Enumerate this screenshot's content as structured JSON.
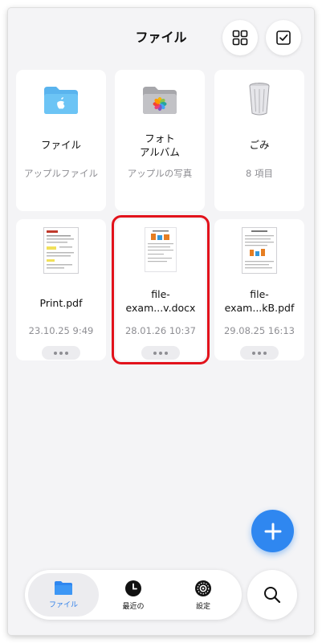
{
  "header": {
    "title": "ファイル",
    "grid_icon": "grid-view-icon",
    "select_icon": "checkbox-select-icon"
  },
  "folders": [
    {
      "name": "ファイル",
      "subtitle": "アップルファイル",
      "icon": "blue-folder-apple-icon"
    },
    {
      "name": "フォト\nアルバム",
      "subtitle": "アップルの写真",
      "icon": "gray-folder-photos-icon"
    },
    {
      "name": "ごみ",
      "subtitle": "8 項目",
      "icon": "trash-bin-icon"
    }
  ],
  "files": [
    {
      "name": "Print.pdf",
      "date": "23.10.25 9:49",
      "icon": "pdf-document-thumbnail"
    },
    {
      "name": "file-\nexam...v.docx",
      "date": "28.01.26 10:37",
      "icon": "docx-document-thumbnail"
    },
    {
      "name": "file-\nexam...kB.pdf",
      "date": "29.08.25 16:13",
      "icon": "pdf-document-thumbnail"
    }
  ],
  "fab": {
    "icon": "plus-icon"
  },
  "tabs": [
    {
      "label": "ファイル",
      "icon": "folder-icon",
      "active": true
    },
    {
      "label": "最近の",
      "icon": "clock-icon",
      "active": false
    },
    {
      "label": "設定",
      "icon": "gear-icon",
      "active": false
    }
  ],
  "search": {
    "icon": "search-icon"
  },
  "colors": {
    "accent": "#2f87f0",
    "highlight": "#e2121b",
    "background": "#f4f4f6"
  }
}
